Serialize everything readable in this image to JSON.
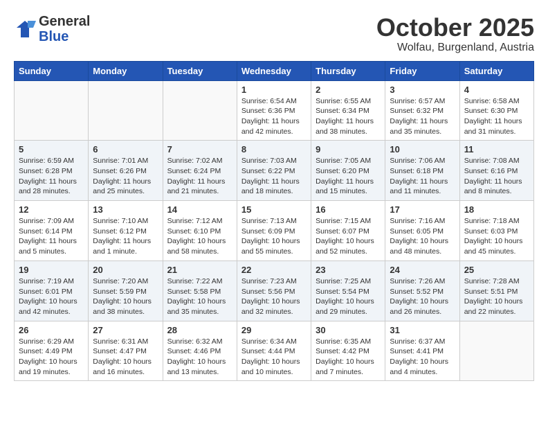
{
  "header": {
    "logo_general": "General",
    "logo_blue": "Blue",
    "month": "October 2025",
    "location": "Wolfau, Burgenland, Austria"
  },
  "weekdays": [
    "Sunday",
    "Monday",
    "Tuesday",
    "Wednesday",
    "Thursday",
    "Friday",
    "Saturday"
  ],
  "weeks": [
    [
      {
        "day": "",
        "info": ""
      },
      {
        "day": "",
        "info": ""
      },
      {
        "day": "",
        "info": ""
      },
      {
        "day": "1",
        "info": "Sunrise: 6:54 AM\nSunset: 6:36 PM\nDaylight: 11 hours\nand 42 minutes."
      },
      {
        "day": "2",
        "info": "Sunrise: 6:55 AM\nSunset: 6:34 PM\nDaylight: 11 hours\nand 38 minutes."
      },
      {
        "day": "3",
        "info": "Sunrise: 6:57 AM\nSunset: 6:32 PM\nDaylight: 11 hours\nand 35 minutes."
      },
      {
        "day": "4",
        "info": "Sunrise: 6:58 AM\nSunset: 6:30 PM\nDaylight: 11 hours\nand 31 minutes."
      }
    ],
    [
      {
        "day": "5",
        "info": "Sunrise: 6:59 AM\nSunset: 6:28 PM\nDaylight: 11 hours\nand 28 minutes."
      },
      {
        "day": "6",
        "info": "Sunrise: 7:01 AM\nSunset: 6:26 PM\nDaylight: 11 hours\nand 25 minutes."
      },
      {
        "day": "7",
        "info": "Sunrise: 7:02 AM\nSunset: 6:24 PM\nDaylight: 11 hours\nand 21 minutes."
      },
      {
        "day": "8",
        "info": "Sunrise: 7:03 AM\nSunset: 6:22 PM\nDaylight: 11 hours\nand 18 minutes."
      },
      {
        "day": "9",
        "info": "Sunrise: 7:05 AM\nSunset: 6:20 PM\nDaylight: 11 hours\nand 15 minutes."
      },
      {
        "day": "10",
        "info": "Sunrise: 7:06 AM\nSunset: 6:18 PM\nDaylight: 11 hours\nand 11 minutes."
      },
      {
        "day": "11",
        "info": "Sunrise: 7:08 AM\nSunset: 6:16 PM\nDaylight: 11 hours\nand 8 minutes."
      }
    ],
    [
      {
        "day": "12",
        "info": "Sunrise: 7:09 AM\nSunset: 6:14 PM\nDaylight: 11 hours\nand 5 minutes."
      },
      {
        "day": "13",
        "info": "Sunrise: 7:10 AM\nSunset: 6:12 PM\nDaylight: 11 hours\nand 1 minute."
      },
      {
        "day": "14",
        "info": "Sunrise: 7:12 AM\nSunset: 6:10 PM\nDaylight: 10 hours\nand 58 minutes."
      },
      {
        "day": "15",
        "info": "Sunrise: 7:13 AM\nSunset: 6:09 PM\nDaylight: 10 hours\nand 55 minutes."
      },
      {
        "day": "16",
        "info": "Sunrise: 7:15 AM\nSunset: 6:07 PM\nDaylight: 10 hours\nand 52 minutes."
      },
      {
        "day": "17",
        "info": "Sunrise: 7:16 AM\nSunset: 6:05 PM\nDaylight: 10 hours\nand 48 minutes."
      },
      {
        "day": "18",
        "info": "Sunrise: 7:18 AM\nSunset: 6:03 PM\nDaylight: 10 hours\nand 45 minutes."
      }
    ],
    [
      {
        "day": "19",
        "info": "Sunrise: 7:19 AM\nSunset: 6:01 PM\nDaylight: 10 hours\nand 42 minutes."
      },
      {
        "day": "20",
        "info": "Sunrise: 7:20 AM\nSunset: 5:59 PM\nDaylight: 10 hours\nand 38 minutes."
      },
      {
        "day": "21",
        "info": "Sunrise: 7:22 AM\nSunset: 5:58 PM\nDaylight: 10 hours\nand 35 minutes."
      },
      {
        "day": "22",
        "info": "Sunrise: 7:23 AM\nSunset: 5:56 PM\nDaylight: 10 hours\nand 32 minutes."
      },
      {
        "day": "23",
        "info": "Sunrise: 7:25 AM\nSunset: 5:54 PM\nDaylight: 10 hours\nand 29 minutes."
      },
      {
        "day": "24",
        "info": "Sunrise: 7:26 AM\nSunset: 5:52 PM\nDaylight: 10 hours\nand 26 minutes."
      },
      {
        "day": "25",
        "info": "Sunrise: 7:28 AM\nSunset: 5:51 PM\nDaylight: 10 hours\nand 22 minutes."
      }
    ],
    [
      {
        "day": "26",
        "info": "Sunrise: 6:29 AM\nSunset: 4:49 PM\nDaylight: 10 hours\nand 19 minutes."
      },
      {
        "day": "27",
        "info": "Sunrise: 6:31 AM\nSunset: 4:47 PM\nDaylight: 10 hours\nand 16 minutes."
      },
      {
        "day": "28",
        "info": "Sunrise: 6:32 AM\nSunset: 4:46 PM\nDaylight: 10 hours\nand 13 minutes."
      },
      {
        "day": "29",
        "info": "Sunrise: 6:34 AM\nSunset: 4:44 PM\nDaylight: 10 hours\nand 10 minutes."
      },
      {
        "day": "30",
        "info": "Sunrise: 6:35 AM\nSunset: 4:42 PM\nDaylight: 10 hours\nand 7 minutes."
      },
      {
        "day": "31",
        "info": "Sunrise: 6:37 AM\nSunset: 4:41 PM\nDaylight: 10 hours\nand 4 minutes."
      },
      {
        "day": "",
        "info": ""
      }
    ]
  ]
}
